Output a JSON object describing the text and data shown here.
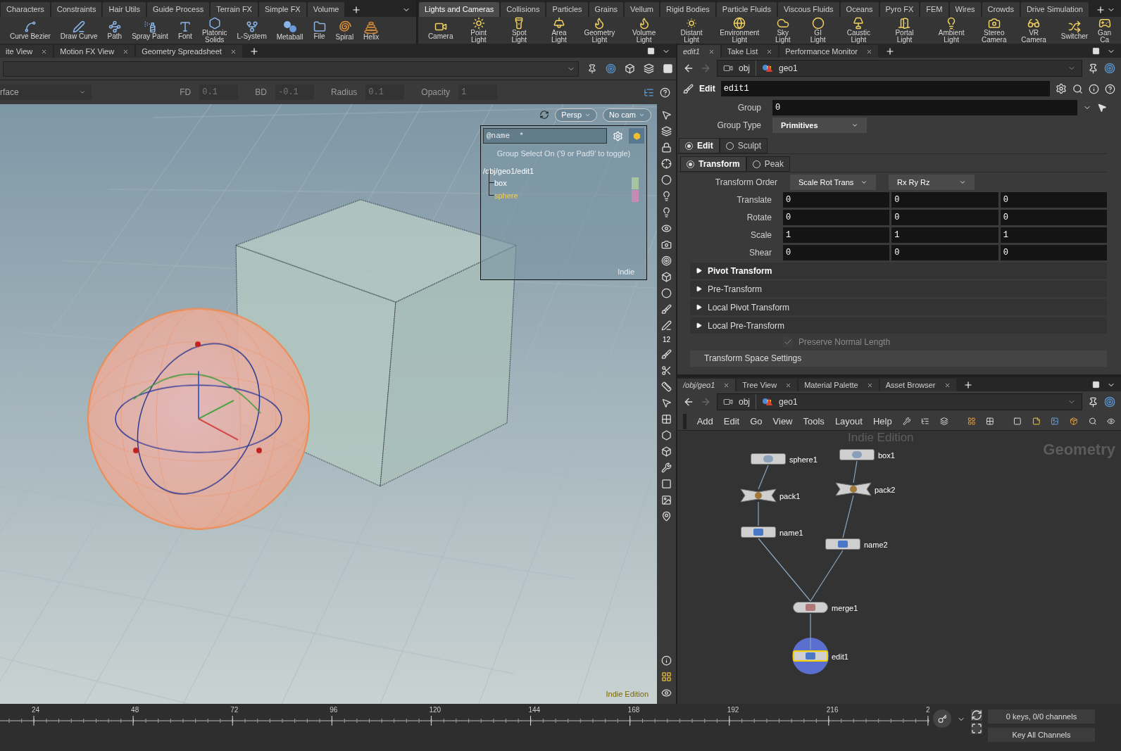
{
  "shelf_left": {
    "tabs": [
      {
        "label": "Characters",
        "selected": false
      },
      {
        "label": "Constraints",
        "selected": false
      },
      {
        "label": "Hair Utils",
        "selected": false
      },
      {
        "label": "Guide Process",
        "selected": false
      },
      {
        "label": "Terrain FX",
        "selected": false
      },
      {
        "label": "Simple FX",
        "selected": false
      },
      {
        "label": "Volume",
        "selected": false
      }
    ],
    "tools": [
      "Curve Bezier",
      "Draw Curve",
      "Path",
      "Spray Paint",
      "Font",
      "Platonic\nSolids",
      "L-System",
      "Metaball",
      "File",
      "Spiral",
      "Helix"
    ]
  },
  "shelf_right": {
    "tabs": [
      {
        "label": "Lights and Cameras",
        "selected": true
      },
      {
        "label": "Collisions",
        "selected": false
      },
      {
        "label": "Particles",
        "selected": false
      },
      {
        "label": "Grains",
        "selected": false
      },
      {
        "label": "Vellum",
        "selected": false
      },
      {
        "label": "Rigid Bodies",
        "selected": false
      },
      {
        "label": "Particle Fluids",
        "selected": false
      },
      {
        "label": "Viscous Fluids",
        "selected": false
      },
      {
        "label": "Oceans",
        "selected": false
      },
      {
        "label": "Pyro FX",
        "selected": false
      },
      {
        "label": "FEM",
        "selected": false
      },
      {
        "label": "Wires",
        "selected": false
      },
      {
        "label": "Crowds",
        "selected": false
      },
      {
        "label": "Drive Simulation",
        "selected": false
      }
    ],
    "tools": [
      "Camera",
      "Point Light",
      "Spot Light",
      "Area Light",
      "Geometry\nLight",
      "Volume Light",
      "Distant Light",
      "Environment\nLight",
      "Sky Light",
      "GI Light",
      "Caustic Light",
      "Portal Light",
      "Ambient Light",
      "Stereo\nCamera",
      "VR Camera",
      "Switcher",
      "Gan\nCa"
    ]
  },
  "viewer": {
    "tabs": [
      {
        "label": "ite View",
        "selected": false
      },
      {
        "label": "Motion FX View",
        "selected": false
      },
      {
        "label": "Geometry Spreadsheet",
        "selected": false
      }
    ],
    "selection_type": "rface",
    "options": [
      {
        "label": "FD",
        "value": "0.1",
        "disabled": true
      },
      {
        "label": "BD",
        "value": "-0.1",
        "disabled": true
      },
      {
        "label": "Radius",
        "value": "0.1",
        "disabled": true
      },
      {
        "label": "Opacity",
        "value": "1",
        "disabled": true
      }
    ],
    "camera_menus": [
      "Persp",
      "No cam"
    ],
    "tool_label": "12",
    "group_list": {
      "filter": "@name  *",
      "message": "Group Select On ('9 or Pad9' to toggle)",
      "root": "/obj/geo1/edit1",
      "groups": [
        {
          "label": "box",
          "color": "#a6c4a0",
          "selected": false
        },
        {
          "label": "sphere",
          "color": "#c48cb4",
          "selected": true
        }
      ],
      "badge": "Indie"
    },
    "edition": "Indie Edition"
  },
  "parameters": {
    "tabs": [
      {
        "label": "edit1",
        "selected": true
      },
      {
        "label": "Take List",
        "selected": false
      },
      {
        "label": "Performance Monitor",
        "selected": false
      }
    ],
    "path": [
      "obj",
      "geo1"
    ],
    "node_type": "Edit",
    "node_name": "edit1",
    "group": {
      "label": "Group",
      "value": "0"
    },
    "group_type": {
      "label": "Group Type",
      "value": "Primitives"
    },
    "modes": [
      {
        "label": "Edit",
        "selected": true
      },
      {
        "label": "Sculpt",
        "selected": false
      }
    ],
    "submodes": [
      {
        "label": "Transform",
        "selected": true
      },
      {
        "label": "Peak",
        "selected": false
      }
    ],
    "transform_order": {
      "label": "Transform Order",
      "values": [
        "Scale Rot Trans",
        "Rx Ry Rz"
      ]
    },
    "vectors": [
      {
        "label": "Translate",
        "values": [
          "0",
          "0",
          "0"
        ]
      },
      {
        "label": "Rotate",
        "values": [
          "0",
          "0",
          "0"
        ]
      },
      {
        "label": "Scale",
        "values": [
          "1",
          "1",
          "1"
        ]
      },
      {
        "label": "Shear",
        "values": [
          "0",
          "0",
          "0"
        ]
      }
    ],
    "folders": [
      {
        "label": "Pivot Transform",
        "expanded": false,
        "bold": true
      },
      {
        "label": "Pre-Transform",
        "expanded": false,
        "bold": false
      },
      {
        "label": "Local Pivot Transform",
        "expanded": false,
        "bold": false
      },
      {
        "label": "Local Pre-Transform",
        "expanded": false,
        "bold": false
      }
    ],
    "preserve_normal_length": {
      "label": "Preserve Normal Length",
      "checked": true,
      "disabled": true
    },
    "section": "Transform Space Settings"
  },
  "network": {
    "tabs": [
      {
        "label": "/obj/geo1",
        "selected": true
      },
      {
        "label": "Tree View",
        "selected": false
      },
      {
        "label": "Material Palette",
        "selected": false
      },
      {
        "label": "Asset Browser",
        "selected": false
      }
    ],
    "path": [
      "obj",
      "geo1"
    ],
    "menu": [
      "Add",
      "Edit",
      "Go",
      "View",
      "Tools",
      "Layout",
      "Help"
    ],
    "watermark": "Indie Edition",
    "context": "Geometry",
    "nodes": [
      {
        "name": "sphere1",
        "kind": "generator",
        "selected": false,
        "display": false
      },
      {
        "name": "box1",
        "kind": "generator",
        "selected": false,
        "display": false
      },
      {
        "name": "pack1",
        "kind": "pack",
        "selected": false,
        "display": false
      },
      {
        "name": "pack2",
        "kind": "pack",
        "selected": false,
        "display": false
      },
      {
        "name": "name1",
        "kind": "attribute",
        "selected": false,
        "display": false
      },
      {
        "name": "name2",
        "kind": "attribute",
        "selected": false,
        "display": false
      },
      {
        "name": "merge1",
        "kind": "merge",
        "selected": false,
        "display": false
      },
      {
        "name": "edit1",
        "kind": "attribute",
        "selected": true,
        "display": true
      }
    ]
  },
  "timeline": {
    "ticks": [
      "24",
      "48",
      "72",
      "96",
      "120",
      "144",
      "168",
      "192",
      "216",
      "2"
    ],
    "keys": "0 keys, 0/0 channels",
    "key_all": "Key All Channels"
  }
}
